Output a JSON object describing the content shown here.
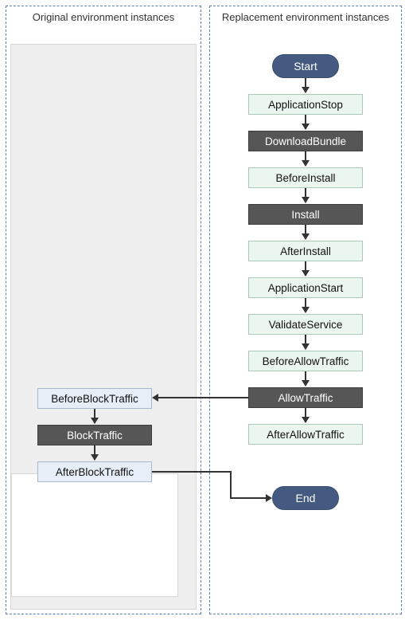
{
  "panels": {
    "left_title": "Original environment instances",
    "right_title": "Replacement environment instances"
  },
  "nodes": {
    "start": "Start",
    "application_stop": "ApplicationStop",
    "download_bundle": "DownloadBundle",
    "before_install": "BeforeInstall",
    "install": "Install",
    "after_install": "AfterInstall",
    "application_start": "ApplicationStart",
    "validate_service": "ValidateService",
    "before_allow_traffic": "BeforeAllowTraffic",
    "allow_traffic": "AllowTraffic",
    "after_allow_traffic": "AfterAllowTraffic",
    "before_block_traffic": "BeforeBlockTraffic",
    "block_traffic": "BlockTraffic",
    "after_block_traffic": "AfterBlockTraffic",
    "end": "End"
  },
  "flow": {
    "right_sequence": [
      "start",
      "application_stop",
      "download_bundle",
      "before_install",
      "install",
      "after_install",
      "application_start",
      "validate_service",
      "before_allow_traffic",
      "allow_traffic",
      "after_allow_traffic"
    ],
    "left_sequence": [
      "before_block_traffic",
      "block_traffic",
      "after_block_traffic"
    ],
    "cross_edges": [
      {
        "from": "allow_traffic",
        "to": "before_block_traffic"
      },
      {
        "from": "after_block_traffic",
        "to": "end"
      }
    ]
  },
  "colors": {
    "dashed_border": "#5b7fb3",
    "pill_bg": "#445a81",
    "dark_bg": "#565656",
    "light_bg": "#ecf6f0",
    "light_blue_bg": "#e6eef7",
    "gray_bg": "#eeeeee"
  }
}
